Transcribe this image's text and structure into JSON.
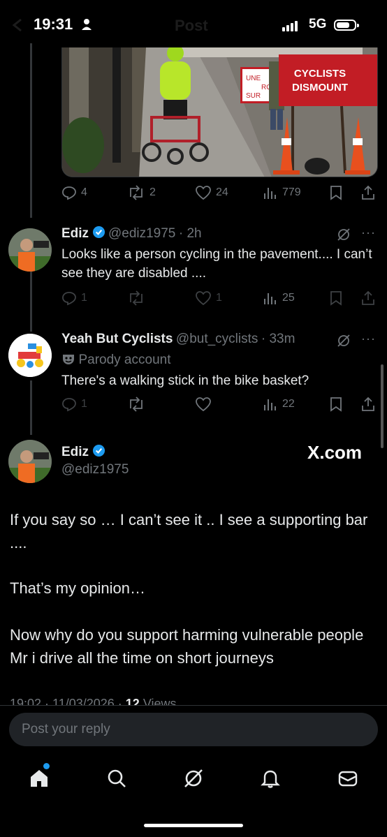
{
  "status_bar": {
    "time": "19:31",
    "network": "5G"
  },
  "header": {
    "title": "Post"
  },
  "first_post_actions": {
    "replies": "4",
    "reposts": "2",
    "likes": "24",
    "views": "779"
  },
  "photo_signs": {
    "sign_main_line1": "CYCLISTS",
    "sign_main_line2": "DISMOUNT",
    "sign_back_line1": "UNE",
    "sign_back_line2": "RO",
    "sign_back_line3": "SUR"
  },
  "reply1": {
    "name": "Ediz",
    "handle": "@ediz1975",
    "time": "· 2h",
    "text": "Looks like a person cycling in the pavement.... I can’t see they are disabled ....",
    "replies": "1",
    "likes": "1",
    "views": "25"
  },
  "reply2": {
    "name": "Yeah But Cyclists",
    "handle": "@but_cyclists",
    "time": "· 33m",
    "badge": "Parody account",
    "text": "There's a walking stick in the bike basket?",
    "replies": "1",
    "views": "22"
  },
  "main_post": {
    "name": "Ediz",
    "handle": "@ediz1975",
    "watermark": "X.com",
    "paragraphs": [
      "If you say so … I can’t see it .. I see a supporting bar ....",
      "That’s my opinion…",
      "Now why do you support harming vulnerable people Mr i drive all the time on short journeys"
    ],
    "meta_time": "19:02 · 11/03/2026 · ",
    "meta_views": "12",
    "meta_views_label": " Views"
  },
  "reply_box": {
    "placeholder": "Post your reply"
  },
  "colors": {
    "accent": "#1d9bf0",
    "background": "#000000",
    "muted": "#71767b"
  }
}
